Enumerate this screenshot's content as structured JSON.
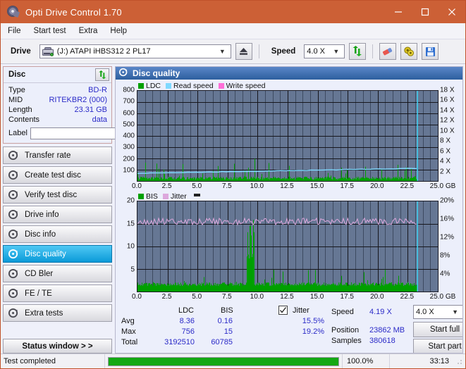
{
  "window": {
    "title": "Opti Drive Control 1.70",
    "icon": "disc-icon",
    "minimize": "minimize",
    "maximize": "maximize",
    "close": "close"
  },
  "menu": [
    "File",
    "Start test",
    "Extra",
    "Help"
  ],
  "toolbar": {
    "drive_label": "Drive",
    "drive_value": "(J:)   ATAPI iHBS312   2 PL17",
    "eject_icon": "eject-icon",
    "speed_label": "Speed",
    "speed_value": "4.0 X",
    "refresh_icon": "refresh-icon",
    "eraser_icon": "eraser-icon",
    "settings_icon": "gear-icon",
    "save_icon": "save-icon"
  },
  "disc_panel": {
    "title": "Disc",
    "refresh_icon": "refresh-icon",
    "rows": [
      {
        "key": "Type",
        "value": "BD-R"
      },
      {
        "key": "MID",
        "value": "RITEKBR2 (000)"
      },
      {
        "key": "Length",
        "value": "23.31 GB"
      },
      {
        "key": "Contents",
        "value": "data"
      }
    ],
    "label_key": "Label",
    "label_value": "",
    "label_button_icon": "disc-icon"
  },
  "sidebar": {
    "items": [
      {
        "label": "Transfer rate",
        "icon": "disc-icon",
        "active": false
      },
      {
        "label": "Create test disc",
        "icon": "disc-icon",
        "active": false
      },
      {
        "label": "Verify test disc",
        "icon": "disc-icon",
        "active": false
      },
      {
        "label": "Drive info",
        "icon": "disc-icon",
        "active": false
      },
      {
        "label": "Disc info",
        "icon": "disc-icon",
        "active": false
      },
      {
        "label": "Disc quality",
        "icon": "disc-icon",
        "active": true
      },
      {
        "label": "CD Bler",
        "icon": "disc-icon",
        "active": false
      },
      {
        "label": "FE / TE",
        "icon": "disc-icon",
        "active": false
      },
      {
        "label": "Extra tests",
        "icon": "disc-icon",
        "active": false
      }
    ],
    "status_window": "Status window > >"
  },
  "content": {
    "title": "Disc quality",
    "icon": "disc-icon"
  },
  "chart_data": [
    {
      "type": "line",
      "name": "top-chart",
      "title": "Disc quality",
      "xlabel": "GB",
      "ylabel": "",
      "xlim": [
        0.0,
        25.0
      ],
      "x_ticks": [
        "0.0",
        "2.5",
        "5.0",
        "7.5",
        "10.0",
        "12.5",
        "15.0",
        "17.5",
        "20.0",
        "22.5",
        "25.0 GB"
      ],
      "ylim": [
        0,
        800
      ],
      "y_ticks": [
        "100",
        "200",
        "300",
        "400",
        "500",
        "600",
        "700",
        "800"
      ],
      "y2lim": [
        0,
        18
      ],
      "y2_ticks": [
        "2 X",
        "4 X",
        "6 X",
        "8 X",
        "10 X",
        "12 X",
        "14 X",
        "16 X",
        "18 X"
      ],
      "grid": true,
      "legend_position": "top-left",
      "series": [
        {
          "name": "LDC",
          "color": "#00a000",
          "type": "bar",
          "avg": 8.36,
          "max": 756,
          "total": 3192510
        },
        {
          "name": "Read speed",
          "color": "#7fd9ff",
          "type": "line",
          "end_value": 4.19
        },
        {
          "name": "Write speed",
          "color": "#ff6fd8",
          "type": "line"
        }
      ],
      "end_marker_gb": 23.31
    },
    {
      "type": "line",
      "name": "bottom-chart",
      "xlabel": "GB",
      "xlim": [
        0.0,
        25.0
      ],
      "x_ticks": [
        "0.0",
        "2.5",
        "5.0",
        "7.5",
        "10.0",
        "12.5",
        "15.0",
        "17.5",
        "20.0",
        "22.5",
        "25.0 GB"
      ],
      "ylim": [
        0,
        20
      ],
      "y_ticks": [
        "5",
        "10",
        "15",
        "20"
      ],
      "y2lim": [
        0,
        20
      ],
      "y2_ticks": [
        "4%",
        "8%",
        "12%",
        "16%",
        "20%"
      ],
      "grid": true,
      "legend_position": "top-left",
      "series": [
        {
          "name": "BIS",
          "color": "#00a000",
          "type": "bar",
          "avg": 0.16,
          "max": 15,
          "total": 60785
        },
        {
          "name": "Jitter",
          "color": "#dda8dd",
          "type": "line",
          "avg": "15.5%",
          "max": "19.2%"
        }
      ],
      "end_marker_gb": 23.31
    }
  ],
  "stats": {
    "col_ldc": "LDC",
    "col_bis": "BIS",
    "jitter_label": "Jitter",
    "jitter_checked": true,
    "rows": [
      {
        "label": "Avg",
        "ldc": "8.36",
        "bis": "0.16",
        "jitter": "15.5%"
      },
      {
        "label": "Max",
        "ldc": "756",
        "bis": "15",
        "jitter": "19.2%"
      },
      {
        "label": "Total",
        "ldc": "3192510",
        "bis": "60785",
        "jitter": ""
      }
    ]
  },
  "controls": {
    "speed_label": "Speed",
    "speed_value": "4.19 X",
    "speed_select": "4.0 X",
    "position_label": "Position",
    "position_value": "23862 MB",
    "samples_label": "Samples",
    "samples_value": "380618",
    "start_full": "Start full",
    "start_part": "Start part"
  },
  "statusbar": {
    "text": "Test completed",
    "progress": "100.0%",
    "progress_pct": 100,
    "time": "33:13"
  }
}
